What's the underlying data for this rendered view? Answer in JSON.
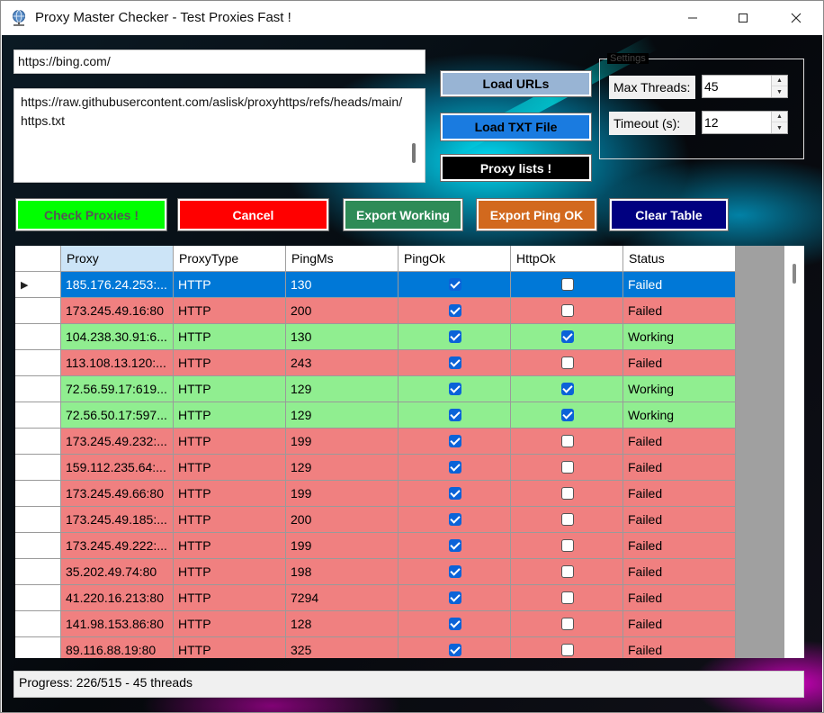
{
  "window": {
    "title": "Proxy Master Checker - Test Proxies Fast !",
    "min_icon": "minimize-icon",
    "max_icon": "maximize-icon",
    "close_icon": "close-icon"
  },
  "inputs": {
    "url_value": "https://bing.com/",
    "proxy_urls_value": "https://raw.githubusercontent.com/aslisk/proxyhttps/refs/heads/main/https.txt"
  },
  "buttons": {
    "load_urls": "Load URLs",
    "load_txt": "Load TXT File",
    "proxy_lists": "Proxy lists !",
    "check": "Check Proxies !",
    "cancel": "Cancel",
    "export_working": "Export Working",
    "export_ping": "Export Ping OK",
    "clear": "Clear Table"
  },
  "settings": {
    "legend": "Settings",
    "threads_label": "Max Threads:",
    "threads_value": "45",
    "timeout_label": "Timeout (s):",
    "timeout_value": "12"
  },
  "table": {
    "columns": [
      "Proxy",
      "ProxyType",
      "PingMs",
      "PingOk",
      "HttpOk",
      "Status"
    ],
    "rows": [
      {
        "proxy": "185.176.24.253:...",
        "type": "HTTP",
        "ping": "130",
        "ping_ok": true,
        "http_ok": false,
        "status": "Failed"
      },
      {
        "proxy": "173.245.49.16:80",
        "type": "HTTP",
        "ping": "200",
        "ping_ok": true,
        "http_ok": false,
        "status": "Failed"
      },
      {
        "proxy": "104.238.30.91:6...",
        "type": "HTTP",
        "ping": "130",
        "ping_ok": true,
        "http_ok": true,
        "status": "Working"
      },
      {
        "proxy": "113.108.13.120:...",
        "type": "HTTP",
        "ping": "243",
        "ping_ok": true,
        "http_ok": false,
        "status": "Failed"
      },
      {
        "proxy": "72.56.59.17:619...",
        "type": "HTTP",
        "ping": "129",
        "ping_ok": true,
        "http_ok": true,
        "status": "Working"
      },
      {
        "proxy": "72.56.50.17:597...",
        "type": "HTTP",
        "ping": "129",
        "ping_ok": true,
        "http_ok": true,
        "status": "Working"
      },
      {
        "proxy": "173.245.49.232:...",
        "type": "HTTP",
        "ping": "199",
        "ping_ok": true,
        "http_ok": false,
        "status": "Failed"
      },
      {
        "proxy": "159.112.235.64:...",
        "type": "HTTP",
        "ping": "129",
        "ping_ok": true,
        "http_ok": false,
        "status": "Failed"
      },
      {
        "proxy": "173.245.49.66:80",
        "type": "HTTP",
        "ping": "199",
        "ping_ok": true,
        "http_ok": false,
        "status": "Failed"
      },
      {
        "proxy": "173.245.49.185:...",
        "type": "HTTP",
        "ping": "200",
        "ping_ok": true,
        "http_ok": false,
        "status": "Failed"
      },
      {
        "proxy": "173.245.49.222:...",
        "type": "HTTP",
        "ping": "199",
        "ping_ok": true,
        "http_ok": false,
        "status": "Failed"
      },
      {
        "proxy": "35.202.49.74:80",
        "type": "HTTP",
        "ping": "198",
        "ping_ok": true,
        "http_ok": false,
        "status": "Failed"
      },
      {
        "proxy": "41.220.16.213:80",
        "type": "HTTP",
        "ping": "7294",
        "ping_ok": true,
        "http_ok": false,
        "status": "Failed"
      },
      {
        "proxy": "141.98.153.86:80",
        "type": "HTTP",
        "ping": "128",
        "ping_ok": true,
        "http_ok": false,
        "status": "Failed"
      },
      {
        "proxy": "89.116.88.19:80",
        "type": "HTTP",
        "ping": "325",
        "ping_ok": true,
        "http_ok": false,
        "status": "Failed"
      }
    ],
    "selected_row": 0
  },
  "colors": {
    "working_row": "#90ee90",
    "failed_row": "#f08080",
    "selected_row": "#0078d7"
  },
  "status": {
    "progress_text": "Progress: 226/515 - 45 threads"
  }
}
